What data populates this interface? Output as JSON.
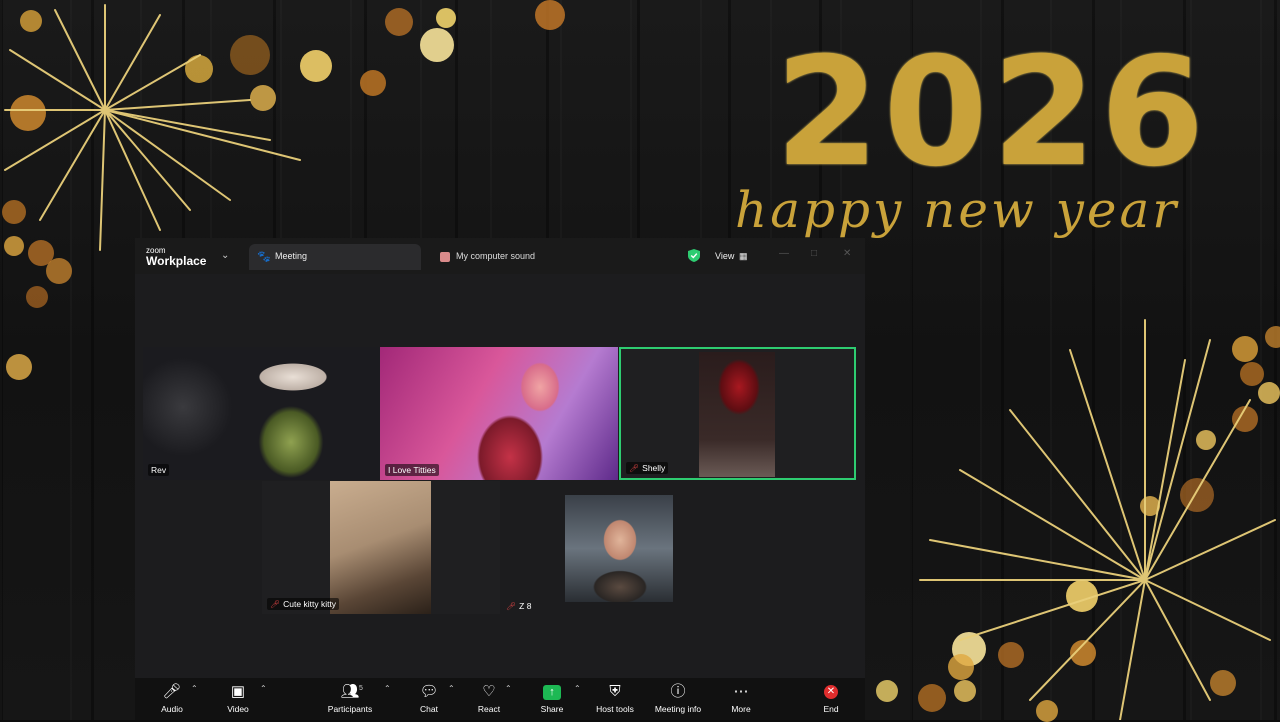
{
  "background": {
    "year": "2026",
    "greeting": "happy new year",
    "accent_color": "#c9a23a"
  },
  "window": {
    "brand_small": "zoom",
    "brand_big": "Workplace",
    "tabs": [
      {
        "label": "Meeting",
        "icon": "paw-icon"
      },
      {
        "label": "My computer sound",
        "icon": "sound-icon"
      }
    ],
    "view_label": "View",
    "security_color": "#2ecc71"
  },
  "participants": [
    {
      "name": "Rev",
      "muted": false
    },
    {
      "name": "I Love Titties",
      "muted": false
    },
    {
      "name": "Shelly",
      "muted": true,
      "active_speaker": true
    },
    {
      "name": "Cute kitty kitty",
      "muted": true
    },
    {
      "name": "Z 8",
      "muted": true
    }
  ],
  "toolbar": {
    "audio": "Audio",
    "video": "Video",
    "participants": "Participants",
    "participants_count": "5",
    "chat": "Chat",
    "react": "React",
    "share": "Share",
    "host_tools": "Host tools",
    "meeting_info": "Meeting info",
    "more": "More",
    "end": "End",
    "end_color": "#e02d2d",
    "share_color": "#1db954"
  }
}
